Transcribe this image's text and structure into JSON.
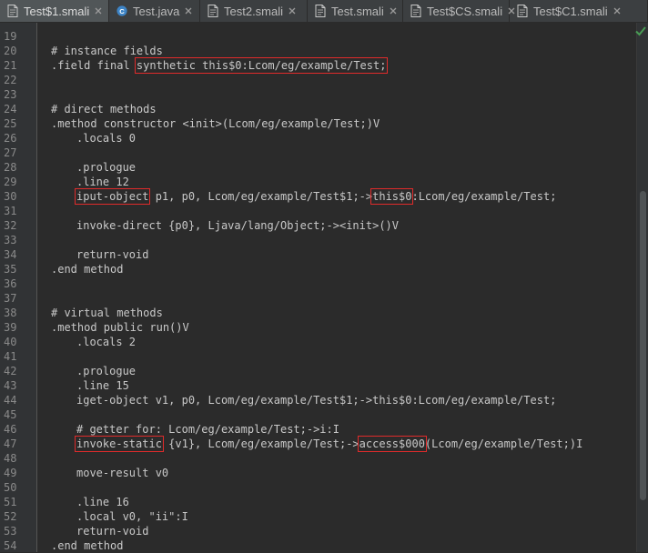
{
  "tabs": [
    {
      "label": "Test$1.smali",
      "icon": "smali-file-icon",
      "active": true
    },
    {
      "label": "Test.java",
      "icon": "java-class-icon",
      "active": false
    },
    {
      "label": "Test2.smali",
      "icon": "smali-file-icon",
      "active": false
    },
    {
      "label": "Test.smali",
      "icon": "smali-file-icon",
      "active": false
    },
    {
      "label": "Test$CS.smali",
      "icon": "smali-file-icon",
      "active": false
    },
    {
      "label": "Test$C1.smali",
      "icon": "smali-file-icon",
      "active": false
    }
  ],
  "lines": [
    {
      "n": "19",
      "parts": []
    },
    {
      "n": "20",
      "parts": [
        {
          "t": "# instance fields"
        }
      ]
    },
    {
      "n": "21",
      "parts": [
        {
          "t": ".field final "
        },
        {
          "t": "synthetic this$0:Lcom/eg/example/Test;",
          "hl": true
        }
      ]
    },
    {
      "n": "22",
      "parts": []
    },
    {
      "n": "23",
      "parts": []
    },
    {
      "n": "24",
      "parts": [
        {
          "t": "# direct methods"
        }
      ]
    },
    {
      "n": "25",
      "parts": [
        {
          "t": ".method constructor <init>(Lcom/eg/example/Test;)V"
        }
      ]
    },
    {
      "n": "26",
      "indent": true,
      "parts": [
        {
          "t": ".locals 0"
        }
      ]
    },
    {
      "n": "27",
      "parts": []
    },
    {
      "n": "28",
      "indent": true,
      "parts": [
        {
          "t": ".prologue"
        }
      ]
    },
    {
      "n": "29",
      "indent": true,
      "parts": [
        {
          "t": ".line 12"
        }
      ]
    },
    {
      "n": "30",
      "indent": true,
      "parts": [
        {
          "t": "iput-object",
          "hl": true
        },
        {
          "t": " p1, p0, Lcom/eg/example/Test$1;->"
        },
        {
          "t": "this$0",
          "hl": true
        },
        {
          "t": ":Lcom/eg/example/Test;"
        }
      ]
    },
    {
      "n": "31",
      "parts": []
    },
    {
      "n": "32",
      "indent": true,
      "parts": [
        {
          "t": "invoke-direct {p0}, Ljava/lang/Object;-><init>()V"
        }
      ]
    },
    {
      "n": "33",
      "parts": []
    },
    {
      "n": "34",
      "indent": true,
      "parts": [
        {
          "t": "return-void"
        }
      ]
    },
    {
      "n": "35",
      "parts": [
        {
          "t": ".end method"
        }
      ]
    },
    {
      "n": "36",
      "parts": []
    },
    {
      "n": "37",
      "parts": []
    },
    {
      "n": "38",
      "parts": [
        {
          "t": "# virtual methods"
        }
      ]
    },
    {
      "n": "39",
      "parts": [
        {
          "t": ".method public run()V"
        }
      ]
    },
    {
      "n": "40",
      "indent": true,
      "parts": [
        {
          "t": ".locals 2"
        }
      ]
    },
    {
      "n": "41",
      "parts": []
    },
    {
      "n": "42",
      "indent": true,
      "parts": [
        {
          "t": ".prologue"
        }
      ]
    },
    {
      "n": "43",
      "indent": true,
      "parts": [
        {
          "t": ".line 15"
        }
      ]
    },
    {
      "n": "44",
      "indent": true,
      "parts": [
        {
          "t": "iget-object v1, p0, Lcom/eg/example/Test$1;->this$0:Lcom/eg/example/Test;"
        }
      ]
    },
    {
      "n": "45",
      "parts": []
    },
    {
      "n": "46",
      "indent": true,
      "parts": [
        {
          "t": "# getter for: Lcom/eg/example/Test;->i:I"
        }
      ]
    },
    {
      "n": "47",
      "indent": true,
      "parts": [
        {
          "t": "invoke-static",
          "hl": true
        },
        {
          "t": " {v1}, Lcom/eg/example/Test;->"
        },
        {
          "t": "access$000",
          "hl": true
        },
        {
          "t": "(Lcom/eg/example/Test;)I"
        }
      ]
    },
    {
      "n": "48",
      "parts": []
    },
    {
      "n": "49",
      "indent": true,
      "parts": [
        {
          "t": "move-result v0"
        }
      ]
    },
    {
      "n": "50",
      "parts": []
    },
    {
      "n": "51",
      "indent": true,
      "parts": [
        {
          "t": ".line 16"
        }
      ]
    },
    {
      "n": "52",
      "indent": true,
      "parts": [
        {
          "t": ".local v0, \"ii\":I"
        }
      ]
    },
    {
      "n": "53",
      "indent": true,
      "parts": [
        {
          "t": "return-void"
        }
      ]
    },
    {
      "n": "54",
      "parts": [
        {
          "t": ".end method"
        }
      ]
    }
  ],
  "colors": {
    "background": "#2b2b2b",
    "gutter": "#313335",
    "text": "#c9c9c9",
    "line_number": "#8a8a8a",
    "highlight_box": "#e02b2b",
    "active_tab": "#515658"
  },
  "status_icon": "inspection-ok-check-icon",
  "scroll": {
    "position": 0.32,
    "visible_fraction": 0.58
  }
}
